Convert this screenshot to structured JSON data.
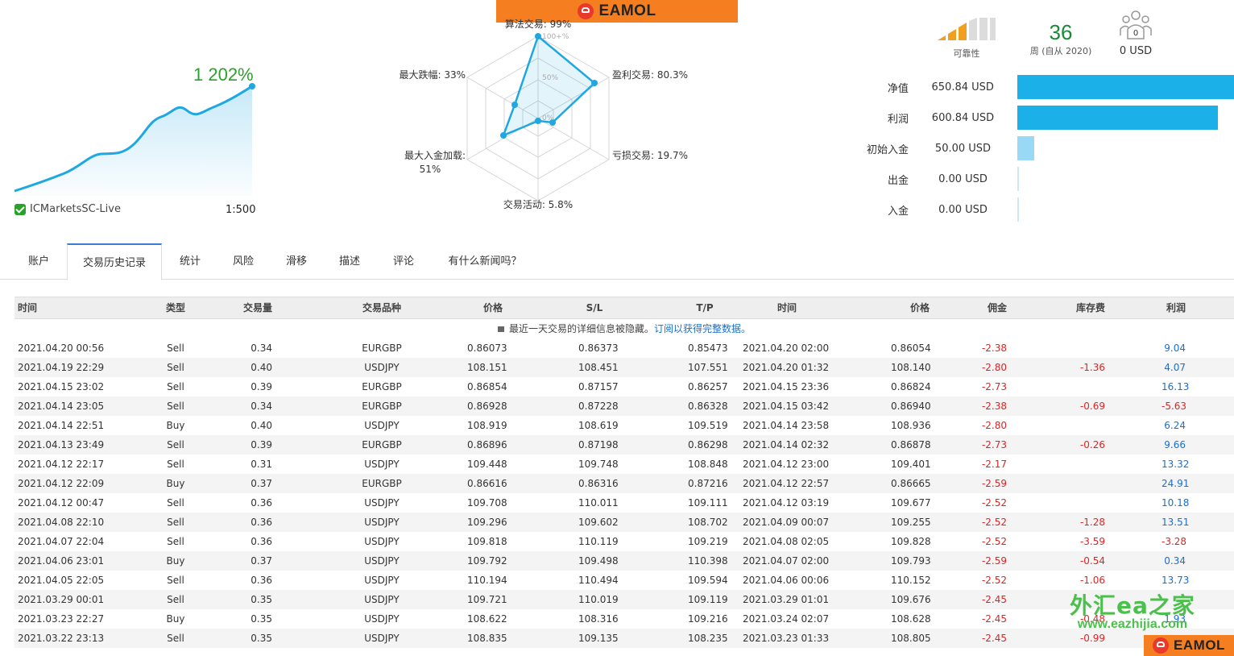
{
  "brand": {
    "name": "EAMOL"
  },
  "growth": {
    "value": "1 202%",
    "broker": "ICMarketsSC-Live",
    "leverage": "1:500"
  },
  "radar": {
    "labels": [
      "算法交易: 99%",
      "盈利交易: 80.3%",
      "亏损交易: 19.7%",
      "交易活动: 5.8%",
      "最大入金加载:",
      "51%",
      "最大跌幅: 33%"
    ],
    "ticks": [
      "100+%",
      "50%",
      "0%"
    ]
  },
  "reliability": {
    "label": "可靠性"
  },
  "weeks": {
    "value": "36",
    "label": "周 (自从 2020)"
  },
  "subscribers": {
    "count": "0",
    "value": "0 USD"
  },
  "balances": [
    {
      "label": "净值",
      "value": "650.84 USD",
      "fraction": 1.0,
      "color": "#1bb0e8"
    },
    {
      "label": "利润",
      "value": "600.84 USD",
      "fraction": 0.923,
      "color": "#1bb0e8"
    },
    {
      "label": "初始入金",
      "value": "50.00 USD",
      "fraction": 0.077,
      "color": "#9ad9f5"
    },
    {
      "label": "出金",
      "value": "0.00 USD",
      "fraction": 0,
      "color": "#9ad9f5"
    },
    {
      "label": "入金",
      "value": "0.00 USD",
      "fraction": 0,
      "color": "#9ad9f5"
    }
  ],
  "tabs": [
    {
      "label": "账户"
    },
    {
      "label": "交易历史记录"
    },
    {
      "label": "统计"
    },
    {
      "label": "风险"
    },
    {
      "label": "滑移"
    },
    {
      "label": "描述"
    },
    {
      "label": "评论"
    },
    {
      "label": "有什么新闻吗？"
    }
  ],
  "table": {
    "headers": [
      "时间",
      "类型",
      "交易量",
      "交易品种",
      "价格",
      "S/L",
      "T/P",
      "时间",
      "价格",
      "佣金",
      "库存费",
      "利润"
    ],
    "notice": "最近一天交易的详细信息被隐藏。",
    "notice_link": "订阅以获得完整数据。",
    "rows": [
      [
        "2021.04.20 00:56",
        "Sell",
        "0.34",
        "EURGBP",
        "0.86073",
        "0.86373",
        "0.85473",
        "2021.04.20 02:00",
        "0.86054",
        "-2.38",
        "",
        "9.04"
      ],
      [
        "2021.04.19 22:29",
        "Sell",
        "0.40",
        "USDJPY",
        "108.151",
        "108.451",
        "107.551",
        "2021.04.20 01:32",
        "108.140",
        "-2.80",
        "-1.36",
        "4.07"
      ],
      [
        "2021.04.15 23:02",
        "Sell",
        "0.39",
        "EURGBP",
        "0.86854",
        "0.87157",
        "0.86257",
        "2021.04.15 23:36",
        "0.86824",
        "-2.73",
        "",
        "16.13"
      ],
      [
        "2021.04.14 23:05",
        "Sell",
        "0.34",
        "EURGBP",
        "0.86928",
        "0.87228",
        "0.86328",
        "2021.04.15 03:42",
        "0.86940",
        "-2.38",
        "-0.69",
        "-5.63"
      ],
      [
        "2021.04.14 22:51",
        "Buy",
        "0.40",
        "USDJPY",
        "108.919",
        "108.619",
        "109.519",
        "2021.04.14 23:58",
        "108.936",
        "-2.80",
        "",
        "6.24"
      ],
      [
        "2021.04.13 23:49",
        "Sell",
        "0.39",
        "EURGBP",
        "0.86896",
        "0.87198",
        "0.86298",
        "2021.04.14 02:32",
        "0.86878",
        "-2.73",
        "-0.26",
        "9.66"
      ],
      [
        "2021.04.12 22:17",
        "Sell",
        "0.31",
        "USDJPY",
        "109.448",
        "109.748",
        "108.848",
        "2021.04.12 23:00",
        "109.401",
        "-2.17",
        "",
        "13.32"
      ],
      [
        "2021.04.12 22:09",
        "Buy",
        "0.37",
        "EURGBP",
        "0.86616",
        "0.86316",
        "0.87216",
        "2021.04.12 22:57",
        "0.86665",
        "-2.59",
        "",
        "24.91"
      ],
      [
        "2021.04.12 00:47",
        "Sell",
        "0.36",
        "USDJPY",
        "109.708",
        "110.011",
        "109.111",
        "2021.04.12 03:19",
        "109.677",
        "-2.52",
        "",
        "10.18"
      ],
      [
        "2021.04.08 22:10",
        "Sell",
        "0.36",
        "USDJPY",
        "109.296",
        "109.602",
        "108.702",
        "2021.04.09 00:07",
        "109.255",
        "-2.52",
        "-1.28",
        "13.51"
      ],
      [
        "2021.04.07 22:04",
        "Sell",
        "0.36",
        "USDJPY",
        "109.818",
        "110.119",
        "109.219",
        "2021.04.08 02:05",
        "109.828",
        "-2.52",
        "-3.59",
        "-3.28"
      ],
      [
        "2021.04.06 23:01",
        "Buy",
        "0.37",
        "USDJPY",
        "109.792",
        "109.498",
        "110.398",
        "2021.04.07 02:00",
        "109.793",
        "-2.59",
        "-0.54",
        "0.34"
      ],
      [
        "2021.04.05 22:05",
        "Sell",
        "0.36",
        "USDJPY",
        "110.194",
        "110.494",
        "109.594",
        "2021.04.06 00:06",
        "110.152",
        "-2.52",
        "-1.06",
        "13.73"
      ],
      [
        "2021.03.29 00:01",
        "Sell",
        "0.35",
        "USDJPY",
        "109.721",
        "110.019",
        "109.119",
        "2021.03.29 01:01",
        "109.676",
        "-2.45",
        "",
        ""
      ],
      [
        "2021.03.23 22:27",
        "Buy",
        "0.35",
        "USDJPY",
        "108.622",
        "108.316",
        "109.216",
        "2021.03.24 02:07",
        "108.628",
        "-2.45",
        "-0.48",
        "1.93"
      ],
      [
        "2021.03.22 23:13",
        "Sell",
        "0.35",
        "USDJPY",
        "108.835",
        "109.135",
        "108.235",
        "2021.03.23 01:33",
        "108.805",
        "-2.45",
        "-0.99",
        ""
      ]
    ]
  },
  "watermark": {
    "cn": "外汇ea之家",
    "url": "www.eazhijia.com"
  }
}
